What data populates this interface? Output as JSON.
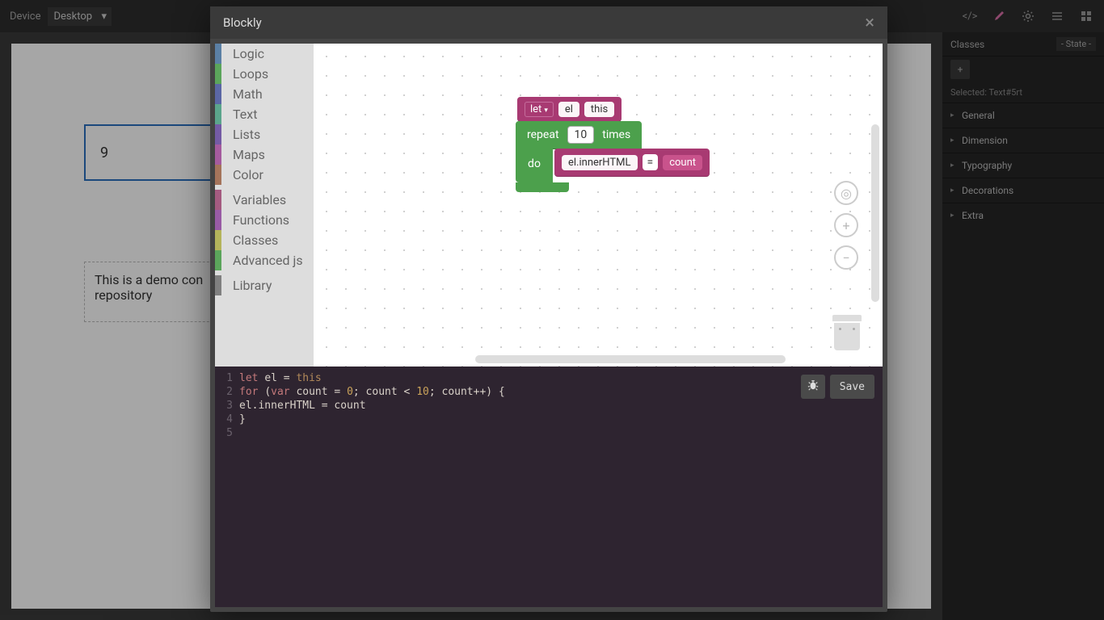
{
  "topbar": {
    "device_label": "Device",
    "device_value": "Desktop",
    "icons": [
      "code-icon",
      "brush-icon",
      "gear-icon",
      "menu-icon",
      "grid-icon"
    ]
  },
  "canvas": {
    "box_value": "9",
    "dashed_text": "This is a demo con repository"
  },
  "right_panel": {
    "classes_label": "Classes",
    "state_label": "- State -",
    "selected_label": "Selected:",
    "selected_value": "Text#5rt",
    "sections": [
      "General",
      "Dimension",
      "Typography",
      "Decorations",
      "Extra"
    ]
  },
  "modal": {
    "title": "Blockly",
    "toolbox": [
      {
        "label": "Logic",
        "color": "#5b80a5"
      },
      {
        "label": "Loops",
        "color": "#5ba55b"
      },
      {
        "label": "Math",
        "color": "#5b67a5"
      },
      {
        "label": "Text",
        "color": "#5ba58c"
      },
      {
        "label": "Lists",
        "color": "#745ba5"
      },
      {
        "label": "Maps",
        "color": "#a55b9e"
      },
      {
        "label": "Color",
        "color": "#a5745b"
      }
    ],
    "toolbox_lower": [
      {
        "label": "Variables",
        "color": "#a55b80"
      },
      {
        "label": "Functions",
        "color": "#995ba5"
      },
      {
        "label": "Classes",
        "color": "#b4b45b"
      },
      {
        "label": "Advanced js",
        "color": "#5ba55b"
      }
    ],
    "toolbox_bottom": [
      {
        "label": "Library",
        "color": "#808080"
      }
    ],
    "blocks": {
      "let_kw": "let",
      "let_var": "el",
      "let_val": "this",
      "repeat_kw": "repeat",
      "repeat_count": "10",
      "repeat_times": "times",
      "repeat_do": "do",
      "set_target": "el.innerHTML",
      "set_op": "=",
      "set_val": "count"
    },
    "code": {
      "lines": [
        [
          {
            "t": "let ",
            "c": "kw"
          },
          {
            "t": "el ",
            "c": "ident"
          },
          {
            "t": "= ",
            "c": "op"
          },
          {
            "t": "this",
            "c": "this"
          }
        ],
        [
          {
            "t": "for ",
            "c": "kw"
          },
          {
            "t": "(",
            "c": "punct"
          },
          {
            "t": "var ",
            "c": "kw"
          },
          {
            "t": "count ",
            "c": "ident"
          },
          {
            "t": "= ",
            "c": "op"
          },
          {
            "t": "0",
            "c": "num"
          },
          {
            "t": "; count < ",
            "c": "ident"
          },
          {
            "t": "10",
            "c": "num"
          },
          {
            "t": "; count++) {",
            "c": "ident"
          }
        ],
        [
          {
            "t": "  el.innerHTML = count",
            "c": "ident"
          }
        ],
        [
          {
            "t": "}",
            "c": "punct"
          }
        ],
        [
          {
            "t": "",
            "c": "ident"
          }
        ]
      ],
      "save_label": "Save"
    }
  }
}
